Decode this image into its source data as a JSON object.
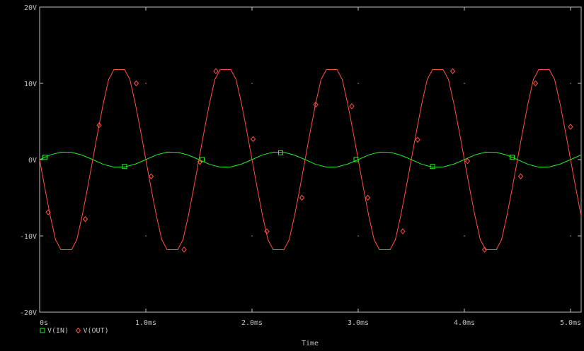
{
  "colors": {
    "background": "#000000",
    "frame": "#c0c0c0",
    "grid_dot": "#c0c0c0",
    "text": "#c0c0c0"
  },
  "chart_data": {
    "type": "line",
    "title": "",
    "xlabel": "Time",
    "ylabel": "",
    "xlim": [
      0,
      5.1
    ],
    "ylim": [
      -20,
      20
    ],
    "x_unit": "ms",
    "y_unit": "V",
    "x_ticks": [
      {
        "value": 0,
        "label": "0s"
      },
      {
        "value": 1,
        "label": "1.0ms"
      },
      {
        "value": 2,
        "label": "2.0ms"
      },
      {
        "value": 3,
        "label": "3.0ms"
      },
      {
        "value": 4,
        "label": "4.0ms"
      },
      {
        "value": 5,
        "label": "5.0ms"
      }
    ],
    "y_ticks": [
      {
        "value": 20,
        "label": "20V"
      },
      {
        "value": 10,
        "label": "10V"
      },
      {
        "value": 0,
        "label": "0V"
      },
      {
        "value": -10,
        "label": "-10V"
      },
      {
        "value": -20,
        "label": "-20V"
      }
    ],
    "grid": "dotted",
    "legend_position": "bottom-left",
    "series": [
      {
        "name": "V(IN)",
        "color": "#22ee22",
        "marker": "square",
        "x": [
          0,
          0.1,
          0.2,
          0.3,
          0.4,
          0.5,
          0.6,
          0.7,
          0.8,
          0.9,
          1.0,
          1.1,
          1.2,
          1.3,
          1.4,
          1.5,
          1.6,
          1.7,
          1.8,
          1.9,
          2.0,
          2.1,
          2.2,
          2.3,
          2.4,
          2.5,
          2.6,
          2.7,
          2.8,
          2.9,
          3.0,
          3.1,
          3.2,
          3.3,
          3.4,
          3.5,
          3.6,
          3.7,
          3.8,
          3.9,
          4.0,
          4.1,
          4.2,
          4.3,
          4.4,
          4.5,
          4.6,
          4.7,
          4.8,
          4.9,
          5.0,
          5.1
        ],
        "y": [
          0.0,
          0.62,
          0.98,
          0.96,
          0.59,
          0.0,
          -0.62,
          -0.98,
          -0.96,
          -0.59,
          0.0,
          0.62,
          0.98,
          0.96,
          0.59,
          0.0,
          -0.62,
          -0.98,
          -0.96,
          -0.59,
          0.0,
          0.62,
          0.98,
          0.96,
          0.59,
          0.0,
          -0.62,
          -0.98,
          -0.96,
          -0.59,
          0.0,
          0.62,
          0.98,
          0.96,
          0.59,
          0.0,
          -0.62,
          -0.98,
          -0.96,
          -0.59,
          0.0,
          0.62,
          0.98,
          0.96,
          0.59,
          0.0,
          -0.62,
          -0.98,
          -0.96,
          -0.59,
          0.0,
          0.62
        ],
        "marker_x": [
          0.05,
          0.8,
          1.53,
          2.27,
          2.98,
          3.7,
          4.45
        ],
        "marker_y": [
          0.3,
          -0.9,
          0.0,
          0.9,
          0.0,
          -0.9,
          0.3
        ]
      },
      {
        "name": "V(OUT)",
        "color": "#ff5040",
        "marker": "diamond",
        "x": [
          0,
          0.05,
          0.1,
          0.15,
          0.2,
          0.25,
          0.3,
          0.35,
          0.4,
          0.45,
          0.5,
          0.55,
          0.6,
          0.65,
          0.7,
          0.75,
          0.8,
          0.85,
          0.9,
          0.95,
          1.0,
          1.05,
          1.1,
          1.15,
          1.2,
          1.25,
          1.3,
          1.35,
          1.4,
          1.45,
          1.5,
          1.55,
          1.6,
          1.65,
          1.7,
          1.75,
          1.8,
          1.85,
          1.9,
          1.95,
          2.0,
          2.05,
          2.1,
          2.15,
          2.2,
          2.25,
          2.3,
          2.35,
          2.4,
          2.45,
          2.5,
          2.55,
          2.6,
          2.65,
          2.7,
          2.75,
          2.8,
          2.85,
          2.9,
          2.95,
          3.0,
          3.05,
          3.1,
          3.15,
          3.2,
          3.25,
          3.3,
          3.35,
          3.4,
          3.45,
          3.5,
          3.55,
          3.6,
          3.65,
          3.7,
          3.75,
          3.8,
          3.85,
          3.9,
          3.95,
          4.0,
          4.05,
          4.1,
          4.15,
          4.2,
          4.25,
          4.3,
          4.35,
          4.4,
          4.45,
          4.5,
          4.55,
          4.6,
          4.65,
          4.7,
          4.75,
          4.8,
          4.85,
          4.9,
          4.95,
          5.0,
          5.05,
          5.1
        ],
        "y": [
          0.0,
          -3.8,
          -7.4,
          -10.5,
          -11.8,
          -11.8,
          -11.8,
          -10.5,
          -7.4,
          -3.8,
          0.0,
          3.8,
          7.4,
          10.5,
          11.8,
          11.8,
          11.8,
          10.5,
          7.4,
          3.8,
          0.0,
          -3.8,
          -7.4,
          -10.5,
          -11.8,
          -11.8,
          -11.8,
          -10.5,
          -7.4,
          -3.8,
          0.0,
          3.8,
          7.4,
          10.5,
          11.8,
          11.8,
          11.8,
          10.5,
          7.4,
          3.8,
          0.0,
          -3.8,
          -7.4,
          -10.5,
          -11.8,
          -11.8,
          -11.8,
          -10.5,
          -7.4,
          -3.8,
          0.0,
          3.8,
          7.4,
          10.5,
          11.8,
          11.8,
          11.8,
          10.5,
          7.4,
          3.8,
          0.0,
          -3.8,
          -7.4,
          -10.5,
          -11.8,
          -11.8,
          -11.8,
          -10.5,
          -7.4,
          -3.8,
          0.0,
          3.8,
          7.4,
          10.5,
          11.8,
          11.8,
          11.8,
          10.5,
          7.4,
          3.8,
          0.0,
          -3.8,
          -7.4,
          -10.5,
          -11.8,
          -11.8,
          -11.8,
          -10.5,
          -7.4,
          -3.8,
          0.0,
          3.8,
          7.4,
          10.5,
          11.8,
          11.8,
          11.8,
          10.5,
          7.4,
          3.8,
          0.0,
          -3.8,
          -7.4
        ],
        "marker_x": [
          0.08,
          0.43,
          0.56,
          0.91,
          1.05,
          1.36,
          1.51,
          1.66,
          2.01,
          2.14,
          2.47,
          2.6,
          2.94,
          3.09,
          3.42,
          3.56,
          3.89,
          4.03,
          4.19,
          4.53,
          4.67,
          5.0
        ],
        "marker_y": [
          -6.9,
          -7.8,
          4.5,
          10.0,
          -2.2,
          -11.8,
          -0.3,
          11.6,
          2.7,
          -9.4,
          -5.0,
          7.2,
          7.0,
          -5.0,
          -9.4,
          2.6,
          11.6,
          -0.2,
          -11.8,
          -2.2,
          10.0,
          4.3
        ]
      }
    ]
  }
}
